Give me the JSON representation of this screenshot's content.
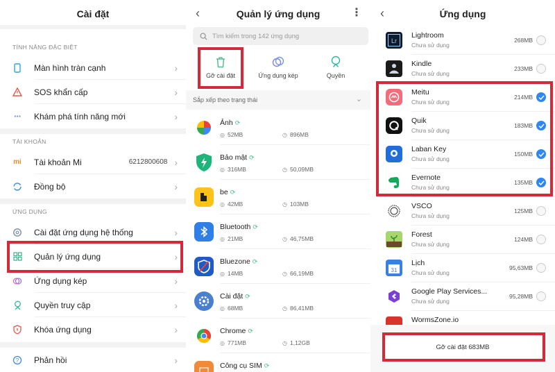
{
  "settings": {
    "title": "Cài đặt",
    "sections": {
      "special": "TÍNH NĂNG ĐẶC BIỆT",
      "account": "TÀI KHOẢN",
      "apps": "ỨNG DỤNG"
    },
    "items": [
      {
        "label": "Màn hình tràn cạnh",
        "icon": "phone-icon"
      },
      {
        "label": "SOS khẩn cấp",
        "icon": "sos-icon"
      },
      {
        "label": "Khám phá tính năng mới",
        "icon": "dots-icon"
      },
      {
        "label": "Tài khoản Mi",
        "value": "6212800608",
        "icon": "mi-icon"
      },
      {
        "label": "Đồng bộ",
        "icon": "sync-icon"
      },
      {
        "label": "Cài đặt ứng dụng hệ thống",
        "icon": "gear-icon"
      },
      {
        "label": "Quản lý ứng dụng",
        "icon": "grid-icon"
      },
      {
        "label": "Ứng dụng kép",
        "icon": "dual-icon"
      },
      {
        "label": "Quyền truy cập",
        "icon": "permission-icon"
      },
      {
        "label": "Khóa ứng dụng",
        "icon": "lock-icon"
      },
      {
        "label": "Phản hồi",
        "icon": "feedback-icon"
      }
    ]
  },
  "manage": {
    "title": "Quản lý ứng dụng",
    "search_placeholder": "Tìm kiếm trong 142 ứng dụng",
    "actions": [
      {
        "label": "Gỡ cài đặt",
        "icon": "trash-icon"
      },
      {
        "label": "Ứng dụng kép",
        "icon": "dual-circle-icon"
      },
      {
        "label": "Quyền",
        "icon": "shield-icon"
      }
    ],
    "sort_label": "Sắp xếp theo trạng thái",
    "apps": [
      {
        "name": "Ảnh",
        "size": "52MB",
        "storage": "896MB"
      },
      {
        "name": "Bảo mật",
        "size": "316MB",
        "storage": "50,09MB"
      },
      {
        "name": "be",
        "size": "42MB",
        "storage": "103MB"
      },
      {
        "name": "Bluetooth",
        "size": "21MB",
        "storage": "46,75MB"
      },
      {
        "name": "Bluezone",
        "size": "14MB",
        "storage": "66,19MB"
      },
      {
        "name": "Cài đặt",
        "size": "68MB",
        "storage": "86,41MB"
      },
      {
        "name": "Chrome",
        "size": "771MB",
        "storage": "1,12GB"
      },
      {
        "name": "Công cụ SIM",
        "size": "",
        "storage": ""
      }
    ]
  },
  "uninstall": {
    "title": "Ứng dụng",
    "apps": [
      {
        "name": "Lightroom",
        "status": "Chưa sử dụng",
        "size": "268MB",
        "checked": false
      },
      {
        "name": "Kindle",
        "status": "Chưa sử dụng",
        "size": "233MB",
        "checked": false
      },
      {
        "name": "Meitu",
        "status": "Chưa sử dụng",
        "size": "214MB",
        "checked": true
      },
      {
        "name": "Quik",
        "status": "Chưa sử dụng",
        "size": "183MB",
        "checked": true
      },
      {
        "name": "Laban Key",
        "status": "Chưa sử dụng",
        "size": "150MB",
        "checked": true
      },
      {
        "name": "Evernote",
        "status": "Chưa sử dụng",
        "size": "135MB",
        "checked": true
      },
      {
        "name": "VSCO",
        "status": "Chưa sử dụng",
        "size": "125MB",
        "checked": false
      },
      {
        "name": "Forest",
        "status": "Chưa sử dụng",
        "size": "124MB",
        "checked": false
      },
      {
        "name": "Lịch",
        "status": "Chưa sử dụng",
        "size": "95,63MB",
        "checked": false
      },
      {
        "name": "Google Play Services...",
        "status": "Chưa sử dụng",
        "size": "95,28MB",
        "checked": false
      },
      {
        "name": "WormsZone.io",
        "status": "",
        "size": "",
        "checked": false
      }
    ],
    "button_label": "Gỡ cài đặt 683MB"
  },
  "colors": {
    "highlight": "#d32a3a",
    "accent": "#2f86f5",
    "loading": "#4dbb88"
  }
}
